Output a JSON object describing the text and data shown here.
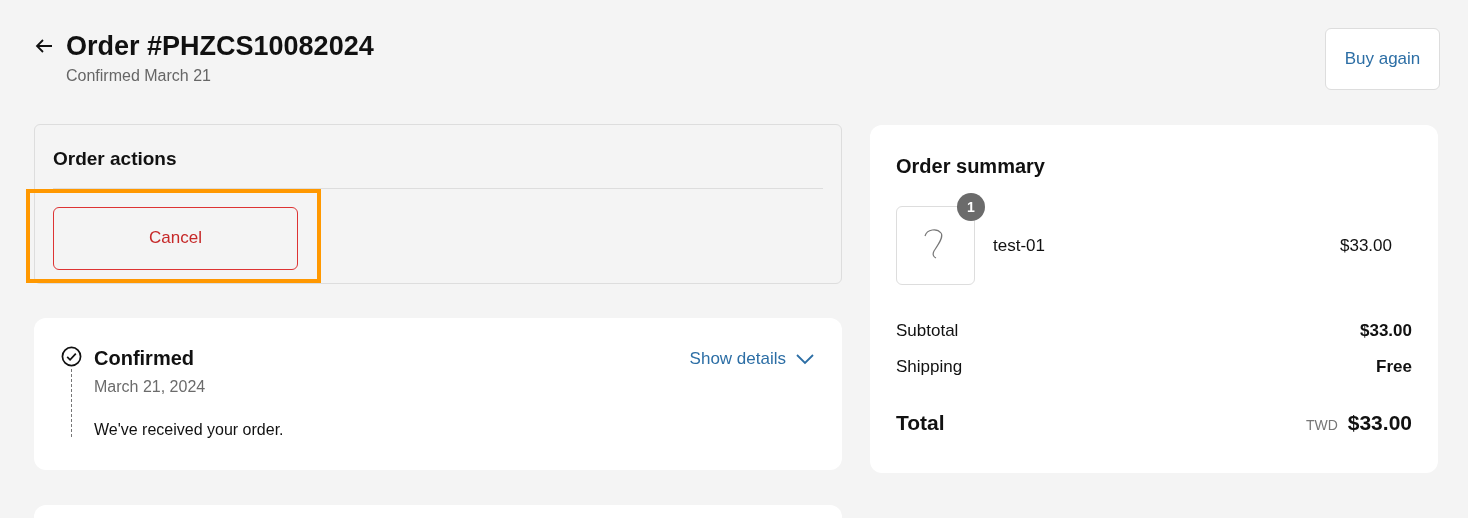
{
  "header": {
    "title": "Order #PHZCS10082024",
    "subtitle": "Confirmed March 21",
    "buy_again": "Buy again"
  },
  "order_actions": {
    "title": "Order actions",
    "cancel": "Cancel",
    "highlighted": true
  },
  "status": {
    "title": "Confirmed",
    "date": "March 21, 2024",
    "message": "We've received your order.",
    "toggle": "Show details",
    "expanded": false
  },
  "summary": {
    "title": "Order summary",
    "items": [
      {
        "name": "test-01",
        "price": "$33.00",
        "quantity": "1"
      }
    ],
    "lines": [
      {
        "label": "Subtotal",
        "value": "$33.00"
      },
      {
        "label": "Shipping",
        "value": "Free"
      }
    ],
    "total": {
      "label": "Total",
      "currency": "TWD",
      "value": "$33.00"
    }
  }
}
